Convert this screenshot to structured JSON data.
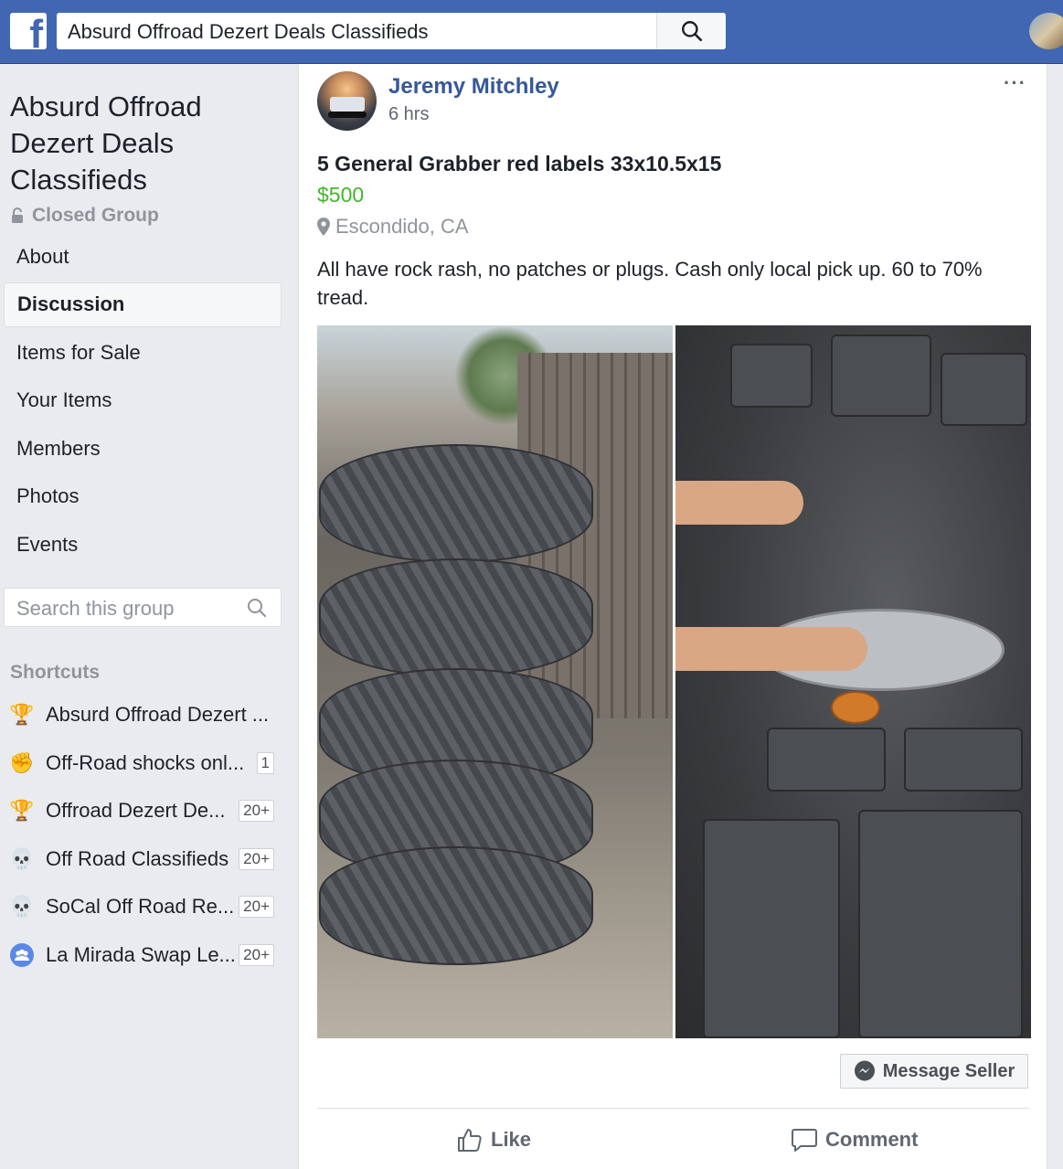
{
  "topbar": {
    "logo_text": "f",
    "search_value": "Absurd Offroad Dezert Deals Classifieds",
    "search_icon": "search-icon",
    "brand_color": "#4267b2"
  },
  "sidebar": {
    "group_name": "Absurd Offroad Dezert Deals Classifieds",
    "privacy": "Closed Group",
    "nav": [
      {
        "label": "About"
      },
      {
        "label": "Discussion",
        "active": true
      },
      {
        "label": "Items for Sale"
      },
      {
        "label": "Your Items"
      },
      {
        "label": "Members"
      },
      {
        "label": "Photos"
      },
      {
        "label": "Events"
      }
    ],
    "search_placeholder": "Search this group",
    "shortcuts_title": "Shortcuts",
    "shortcuts": [
      {
        "label": "Absurd Offroad Dezert ...",
        "icon": "trophy-icon",
        "badge": ""
      },
      {
        "label": "Off-Road shocks onl...",
        "icon": "fist-icon",
        "badge": "1"
      },
      {
        "label": "Offroad Dezert De...",
        "icon": "trophy-icon",
        "badge": "20+"
      },
      {
        "label": "Off Road Classifieds",
        "icon": "skull-icon",
        "badge": "20+"
      },
      {
        "label": "SoCal Off Road Re...",
        "icon": "skull-icon",
        "badge": "20+"
      },
      {
        "label": "La Mirada Swap Le...",
        "icon": "group-icon",
        "badge": "20+"
      }
    ]
  },
  "post": {
    "author": "Jeremy Mitchley",
    "time": "6 hrs",
    "more": "···",
    "title": "5 General Grabber red labels 33x10.5x15",
    "price": "$500",
    "price_color": "#42b72a",
    "location": "Escondido, CA",
    "description": "All have rock rash, no patches or plugs. Cash only local pick up. 60 to 70% tread.",
    "message_button": "Message Seller",
    "like_label": "Like",
    "comment_label": "Comment"
  }
}
